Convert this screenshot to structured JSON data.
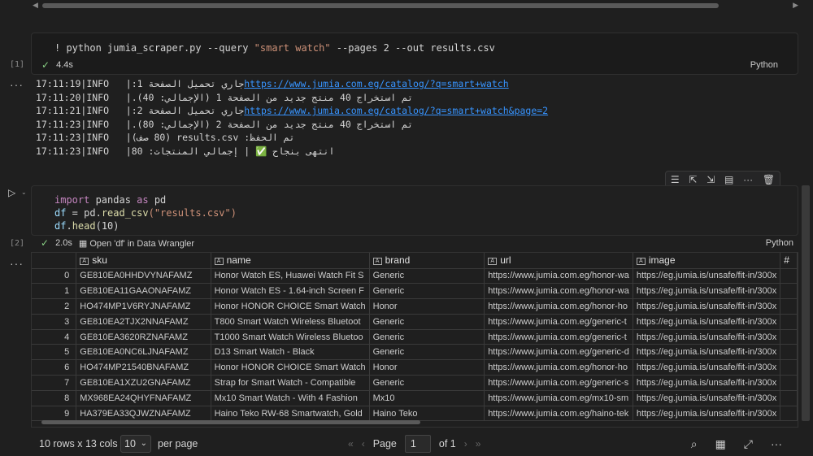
{
  "cell1": {
    "exec_count": "[1]",
    "code": {
      "prefix": "! python jumia_scraper.py --query ",
      "query": "\"smart watch\"",
      "suffix": " --pages 2 --out results.csv"
    },
    "duration": "4.4s",
    "language": "Python"
  },
  "log_lines": [
    {
      "time": "17:11:19",
      "level": "INFO",
      "msg": "جاري تحميل الصفحة 1: ",
      "link": "https://www.jumia.com.eg/catalog/?q=smart+watch"
    },
    {
      "time": "17:11:20",
      "level": "INFO",
      "msg": "تم استخراج 40 منتج جديد من الصفحة 1 (الإجمالي: 40).",
      "link": ""
    },
    {
      "time": "17:11:21",
      "level": "INFO",
      "msg": "جاري تحميل الصفحة 2: ",
      "link": "https://www.jumia.com.eg/catalog/?q=smart+watch&page=2"
    },
    {
      "time": "17:11:23",
      "level": "INFO",
      "msg": "تم استخراج 40 منتج جديد من الصفحة 2 (الإجمالي: 80).",
      "link": ""
    },
    {
      "time": "17:11:23",
      "level": "INFO",
      "msg": "تم الحفظ: results.csv (80 صف)",
      "link": ""
    },
    {
      "time": "17:11:23",
      "level": "INFO",
      "msg": "انتهى بنجاح ✅ | إجمالي المنتجات: 80",
      "link": ""
    }
  ],
  "cell2": {
    "exec_count": "[2]",
    "code_lines": [
      {
        "a": "import",
        "b": " pandas ",
        "c": "as",
        "d": " pd"
      },
      {
        "a": "df",
        "b": " = pd.",
        "c": "read_csv",
        "d": "(\"results.csv\")"
      },
      {
        "a": "df",
        "b": ".",
        "c": "head",
        "d": "(10)"
      }
    ],
    "duration": "2.0s",
    "wrangler_label": "Open 'df' in Data Wrangler",
    "language": "Python"
  },
  "grid": {
    "columns": [
      "sku",
      "name",
      "brand",
      "url",
      "image",
      "#"
    ],
    "rows": [
      [
        "0",
        "GE810EA0HHDVYNAFAMZ",
        "Honor Watch ES, Huawei Watch Fit S",
        "Generic",
        "https://www.jumia.com.eg/honor-wa",
        "https://eg.jumia.is/unsafe/fit-in/300x"
      ],
      [
        "1",
        "GE810EA11GAAONAFAMZ",
        "Honor Watch ES - 1.64-inch Screen F",
        "Generic",
        "https://www.jumia.com.eg/honor-wa",
        "https://eg.jumia.is/unsafe/fit-in/300x"
      ],
      [
        "2",
        "HO474MP1V6RYJNAFAMZ",
        "Honor HONOR CHOICE Smart Watch",
        "Honor",
        "https://www.jumia.com.eg/honor-ho",
        "https://eg.jumia.is/unsafe/fit-in/300x"
      ],
      [
        "3",
        "GE810EA2TJX2NNAFAMZ",
        "T800 Smart Watch Wireless Bluetoot",
        "Generic",
        "https://www.jumia.com.eg/generic-t",
        "https://eg.jumia.is/unsafe/fit-in/300x"
      ],
      [
        "4",
        "GE810EA3620RZNAFAMZ",
        "T1000 Smart Watch Wireless Bluetoo",
        "Generic",
        "https://www.jumia.com.eg/generic-t",
        "https://eg.jumia.is/unsafe/fit-in/300x"
      ],
      [
        "5",
        "GE810EA0NC6LJNAFAMZ",
        "D13 Smart Watch - Black",
        "Generic",
        "https://www.jumia.com.eg/generic-d",
        "https://eg.jumia.is/unsafe/fit-in/300x"
      ],
      [
        "6",
        "HO474MP21540BNAFAMZ",
        "Honor HONOR CHOICE Smart Watch",
        "Honor",
        "https://www.jumia.com.eg/honor-ho",
        "https://eg.jumia.is/unsafe/fit-in/300x"
      ],
      [
        "7",
        "GE810EA1XZU2GNAFAMZ",
        "Strap for Smart Watch - Compatible",
        "Generic",
        "https://www.jumia.com.eg/generic-s",
        "https://eg.jumia.is/unsafe/fit-in/300x"
      ],
      [
        "8",
        "MX968EA24QHYFNAFAMZ",
        "Mx10 Smart Watch - With 4 Fashion",
        "Mx10",
        "https://www.jumia.com.eg/mx10-sm",
        "https://eg.jumia.is/unsafe/fit-in/300x"
      ],
      [
        "9",
        "HA379EA33QJWZNAFAMZ",
        "Haino Teko RW-68 Smartwatch, Gold",
        "Haino Teko",
        "https://www.jumia.com.eg/haino-tek",
        "https://eg.jumia.is/unsafe/fit-in/300x"
      ]
    ]
  },
  "footer": {
    "rows_info": "10 rows x 13 cols",
    "per_page_value": "10",
    "per_page_label": "per page",
    "page_label": "Page",
    "page_value": "1",
    "page_total": "of 1"
  },
  "icons": {
    "run": "play-icon",
    "check": "check-icon",
    "search": "search-icon",
    "table": "table-icon",
    "expand": "expand-icon",
    "more": "more-icon"
  },
  "colors": {
    "background": "#1f1f1f",
    "link": "#3794ff",
    "success": "#89d185",
    "string": "#ce9178",
    "keyword": "#c586c0"
  }
}
